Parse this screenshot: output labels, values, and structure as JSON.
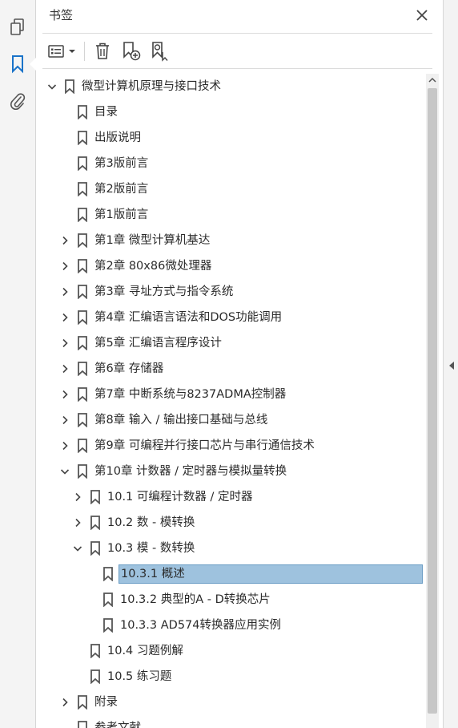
{
  "rail": {
    "icons": [
      "pages-icon",
      "bookmark-icon",
      "attachment-icon"
    ]
  },
  "panel": {
    "title": "书签"
  },
  "toolbar": {
    "buttons": [
      "options-menu-icon",
      "delete-bookmark-icon",
      "new-bookmark-icon",
      "find-bookmark-icon"
    ]
  },
  "tree": [
    {
      "label": "微型计算机原理与接口技术",
      "level": 0,
      "chevron": "down"
    },
    {
      "label": "目录",
      "level": 1,
      "chevron": "none"
    },
    {
      "label": "出版说明",
      "level": 1,
      "chevron": "none"
    },
    {
      "label": "第3版前言",
      "level": 1,
      "chevron": "none"
    },
    {
      "label": "第2版前言",
      "level": 1,
      "chevron": "none"
    },
    {
      "label": "第1版前言",
      "level": 1,
      "chevron": "none"
    },
    {
      "label": "第1章  微型计算机基达",
      "level": 1,
      "chevron": "right"
    },
    {
      "label": "第2章  80x86微处理器",
      "level": 1,
      "chevron": "right"
    },
    {
      "label": "第3章  寻址方式与指令系统",
      "level": 1,
      "chevron": "right"
    },
    {
      "label": "第4章  汇编语言语法和DOS功能调用",
      "level": 1,
      "chevron": "right"
    },
    {
      "label": "第5章  汇编语言程序设计",
      "level": 1,
      "chevron": "right"
    },
    {
      "label": "第6章  存储器",
      "level": 1,
      "chevron": "right"
    },
    {
      "label": "第7章  中断系统与8237ADMA控制器",
      "level": 1,
      "chevron": "right"
    },
    {
      "label": "第8章  输入 / 输出接口基础与总线",
      "level": 1,
      "chevron": "right"
    },
    {
      "label": "第9章  可编程并行接口芯片与串行通信技术",
      "level": 1,
      "chevron": "right"
    },
    {
      "label": "第10章  计数器 / 定时器与模拟量转换",
      "level": 1,
      "chevron": "down"
    },
    {
      "label": "10.1  可编程计数器 / 定时器",
      "level": 2,
      "chevron": "right"
    },
    {
      "label": "10.2  数 - 模转换",
      "level": 2,
      "chevron": "right"
    },
    {
      "label": "10.3  模 - 数转换",
      "level": 2,
      "chevron": "down"
    },
    {
      "label": "10.3.1  概述",
      "level": 3,
      "chevron": "none",
      "selected": true
    },
    {
      "label": "10.3.2  典型的A - D转换芯片",
      "level": 3,
      "chevron": "none"
    },
    {
      "label": "10.3.3  AD574转换器应用实例",
      "level": 3,
      "chevron": "none"
    },
    {
      "label": "10.4  习题例解",
      "level": 2,
      "chevron": "none"
    },
    {
      "label": "10.5  练习题",
      "level": 2,
      "chevron": "none"
    },
    {
      "label": "附录",
      "level": 1,
      "chevron": "right"
    },
    {
      "label": "参考文献",
      "level": 1,
      "chevron": "none"
    }
  ],
  "colors": {
    "selection_bg": "#9ec2de",
    "accent": "#1a73c9"
  }
}
